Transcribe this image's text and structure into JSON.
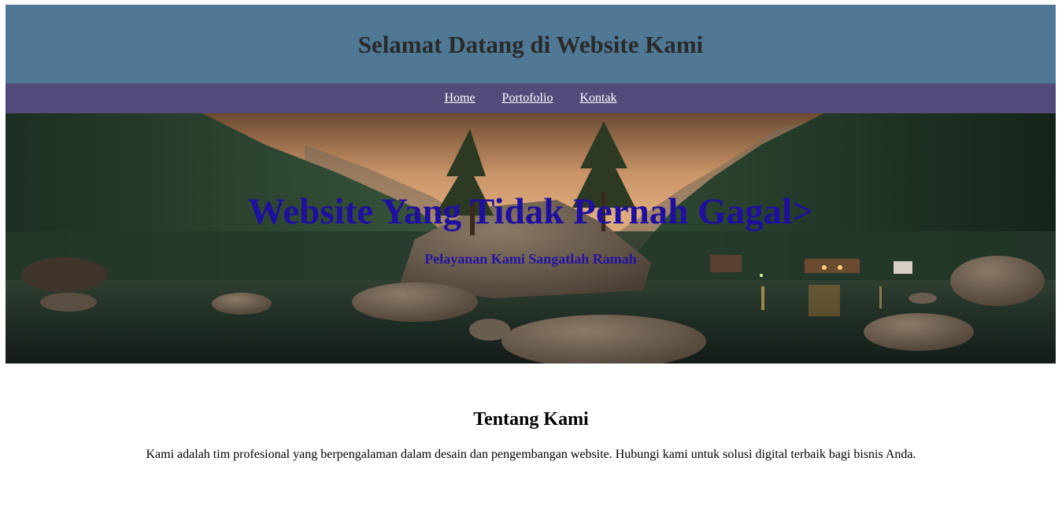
{
  "header": {
    "title": "Selamat Datang di Website Kami"
  },
  "nav": {
    "items": [
      {
        "label": "Home"
      },
      {
        "label": "Portofolio"
      },
      {
        "label": "Kontak"
      }
    ]
  },
  "hero": {
    "title": "Website Yang Tidak Pernah Gagal>",
    "subtitle": "Pelayanan Kami Sangatlah Ramah",
    "image": "mountain-lake-landscape"
  },
  "about": {
    "heading": "Tentang Kami",
    "text": "Kami adalah tim profesional yang berpengalaman dalam desain dan pengembangan website. Hubungi kami untuk solusi digital terbaik bagi bisnis Anda."
  },
  "colors": {
    "header_bg": "#4f7894",
    "nav_bg": "#544a7a",
    "hero_title": "#1f0fa0"
  }
}
